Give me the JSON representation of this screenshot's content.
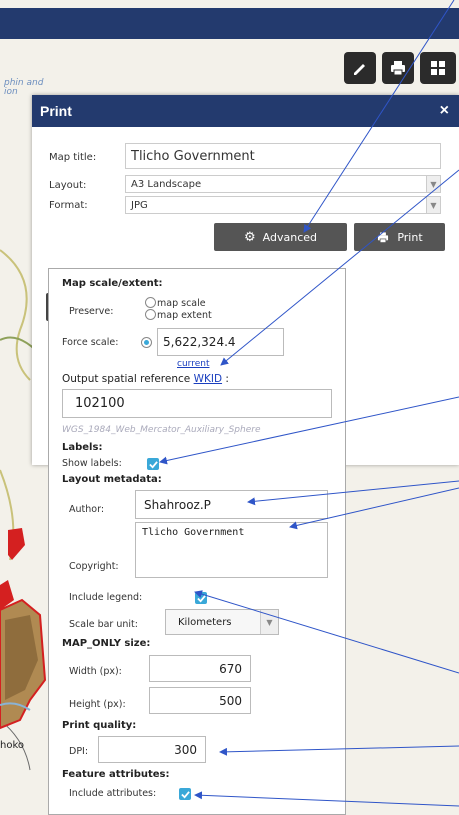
{
  "map": {
    "labels": [
      "phin and",
      "ion",
      "hoko"
    ]
  },
  "toolbar": {
    "icons": [
      "pencil-icon",
      "printer-icon",
      "grid-icon"
    ]
  },
  "print_panel": {
    "title": "Print",
    "close": "×",
    "map_title_label": "Map title:",
    "map_title_value": "Tlicho Government",
    "layout_label": "Layout:",
    "layout_value": "A3 Landscape",
    "format_label": "Format:",
    "format_value": "JPG",
    "advanced_label": "Advanced",
    "print_label": "Print"
  },
  "advanced": {
    "scale_section": "Map scale/extent:",
    "preserve_label": "Preserve:",
    "opt_map_scale": "map scale",
    "opt_map_extent": "map extent",
    "force_scale_label": "Force scale:",
    "force_scale_value": "5,622,324.4",
    "current_link": "current",
    "osr_label": "Output spatial reference",
    "wkid_link": "WKID",
    "osr_colon": ":",
    "wkid_value": "102100",
    "wkid_name": "WGS_1984_Web_Mercator_Auxiliary_Sphere",
    "labels_section": "Labels:",
    "show_labels": "Show labels:",
    "metadata_section": "Layout metadata:",
    "author_label": "Author:",
    "author_value": "Shahrooz.P",
    "copyright_label": "Copyright:",
    "copyright_value": "Tlicho Government",
    "include_legend": "Include legend:",
    "scale_bar_unit_label": "Scale bar unit:",
    "scale_bar_unit_value": "Kilometers",
    "maponly_section": "MAP_ONLY size:",
    "width_label": "Width (px):",
    "width_value": "670",
    "height_label": "Height (px):",
    "height_value": "500",
    "quality_section": "Print quality:",
    "dpi_label": "DPI:",
    "dpi_value": "300",
    "feature_section": "Feature attributes:",
    "include_attributes": "Include attributes:"
  },
  "colors": {
    "header": "#233a6e",
    "check": "#3aa8d8",
    "annotation": "#2f55c8"
  }
}
